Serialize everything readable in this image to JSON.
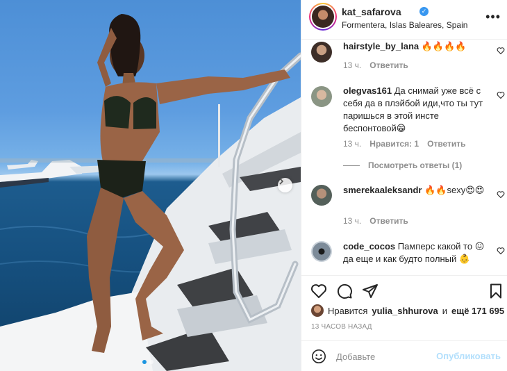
{
  "post": {
    "username": "kat_safarova",
    "verified_mark": "✓",
    "location": "Formentera, Islas Baleares, Spain",
    "more_icon": "more-horizontal-icon",
    "carousel": {
      "slides": 2,
      "active": 1
    }
  },
  "comments": [
    {
      "user": "hairstyle_by_lana",
      "text": "🔥🔥🔥🔥",
      "time": "13 ч.",
      "actions": [
        "Ответить"
      ]
    },
    {
      "user": "olegvas161",
      "text": "Да снимай уже всё с себя да в плэйбой иди,что ты тут паришься в этой инсте беспонтовой😁",
      "time": "13 ч.",
      "actions": [
        "Нравится: 1",
        "Ответить"
      ]
    },
    {
      "user": "smerekaaleksandr",
      "text": "🔥🔥sexy😍😍",
      "time": "13 ч.",
      "actions": [
        "Ответить"
      ]
    },
    {
      "user": "code_cocos",
      "text": "Памперс какой то 😖 да еще и как будто полный 👶",
      "time": "",
      "actions": []
    }
  ],
  "view_replies": "Посмотреть ответы (1)",
  "likes": {
    "prefix": "Нравится",
    "user": "yulia_shhurova",
    "middle": "и",
    "count": "ещё 171 695"
  },
  "timestamp": "13 ЧАСОВ НАЗАД",
  "add_comment": {
    "placeholder": "Добавьте",
    "post_label": "Опубликовать"
  },
  "colors": {
    "link_blue": "#3897f0",
    "post_disabled": "#b2dffc",
    "muted": "#8e8e8e"
  }
}
